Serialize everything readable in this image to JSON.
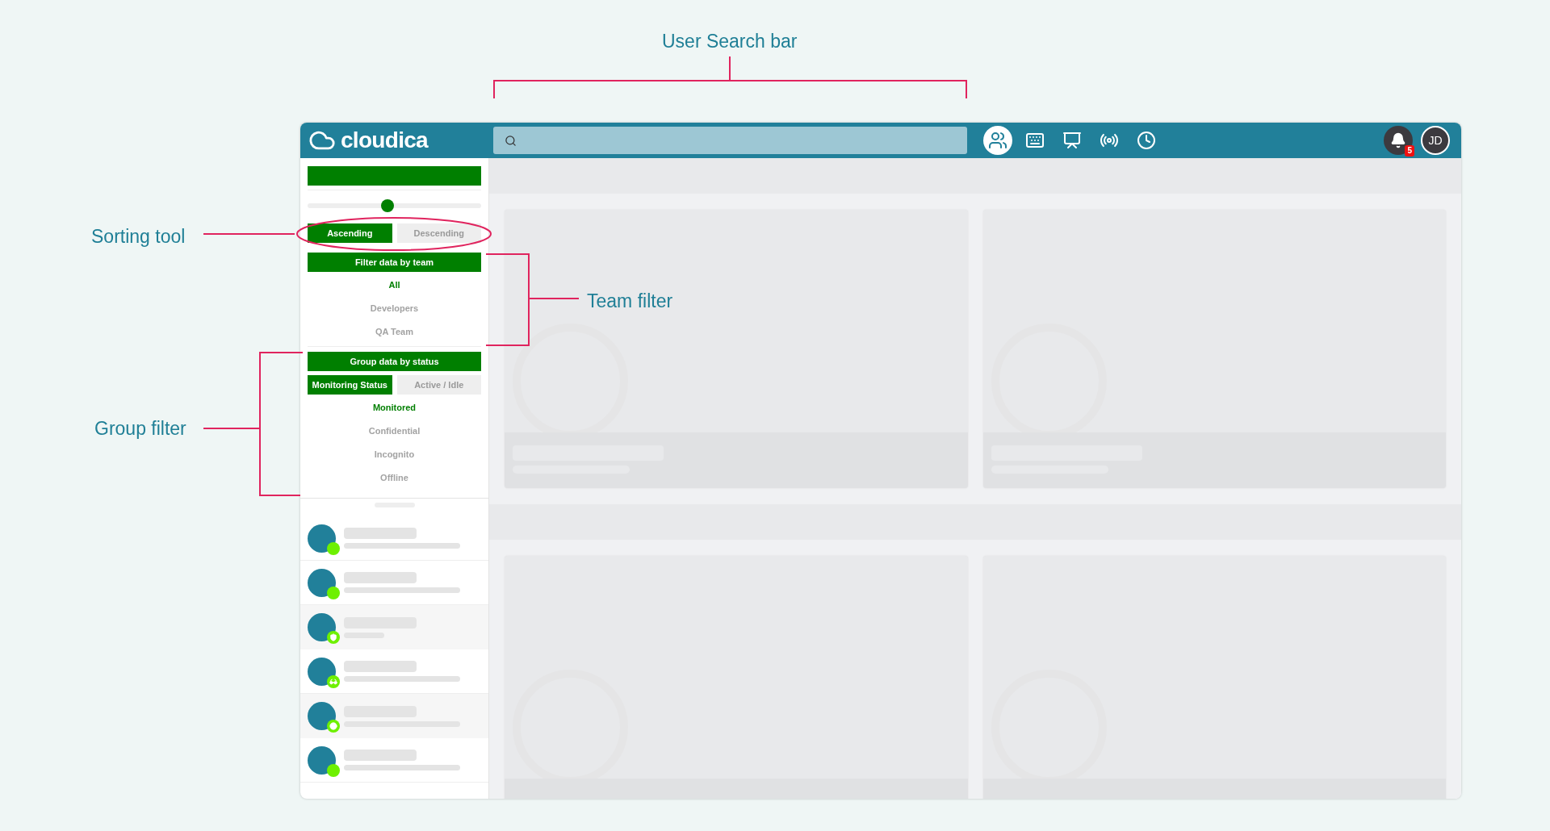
{
  "annotations": [
    {
      "text": "User Search bar"
    },
    {
      "text": "Sorting tool"
    },
    {
      "text": "Team filter"
    },
    {
      "text": "Group filter"
    }
  ],
  "app": {
    "logo": "cloudica",
    "nav_icons": [
      {
        "kind": "team",
        "selected": true
      },
      {
        "kind": "keyboard",
        "selected": false
      },
      {
        "kind": "monitor",
        "selected": false
      },
      {
        "kind": "broadcast",
        "selected": false
      },
      {
        "kind": "clock",
        "selected": false
      }
    ],
    "notifications": "5",
    "avatar": "JD",
    "sidebar": {
      "slider": {
        "level": 0.46
      },
      "sort": [
        {
          "label": "Ascending",
          "selected": true
        },
        {
          "label": "Descending",
          "selected": false
        }
      ],
      "team_header": "Filter data by team",
      "teams": [
        {
          "label": "All",
          "selected": true
        },
        {
          "label": "Developers",
          "selected": false
        },
        {
          "label": "QA Team",
          "selected": false
        }
      ],
      "group_header": "Group data by status",
      "group_modes": [
        {
          "label": "Monitoring Status",
          "selected": true
        },
        {
          "label": "Active / Idle",
          "selected": false
        }
      ],
      "statuses": [
        {
          "label": "Monitored",
          "selected": true
        },
        {
          "label": "Confidential",
          "selected": false
        },
        {
          "label": "Incognito",
          "selected": false
        },
        {
          "label": "Offline",
          "selected": false
        }
      ],
      "users": [
        {
          "kind": "online",
          "highlighted": false
        },
        {
          "kind": "online",
          "highlighted": false
        },
        {
          "kind": "confidential",
          "highlighted": true
        },
        {
          "kind": "incognito",
          "highlighted": false
        },
        {
          "kind": "idle",
          "highlighted": true
        },
        {
          "kind": "online",
          "highlighted": false
        }
      ]
    }
  }
}
